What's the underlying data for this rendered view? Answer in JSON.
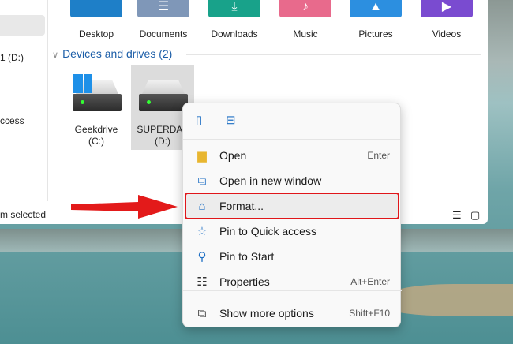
{
  "sidebar": {
    "items": [
      "1 (D:)",
      "ccess"
    ]
  },
  "folders": [
    {
      "label": "Desktop",
      "color": "#1e7fc8"
    },
    {
      "label": "Documents",
      "color": "#7f97b8"
    },
    {
      "label": "Downloads",
      "color": "#18a28a"
    },
    {
      "label": "Music",
      "color": "#e86a8c"
    },
    {
      "label": "Pictures",
      "color": "#2c8fe0"
    },
    {
      "label": "Videos",
      "color": "#7a4bd0"
    }
  ],
  "section": {
    "title": "Devices and drives (2)"
  },
  "drives": [
    {
      "name": "Geekdrive",
      "letter": "(C:)"
    },
    {
      "name": "SUPERDAV",
      "letter": "(D:)"
    }
  ],
  "status": {
    "text": "m selected"
  },
  "menu": {
    "items": [
      {
        "label": "Open",
        "shortcut": "Enter",
        "icon": "folder-icon"
      },
      {
        "label": "Open in new window",
        "shortcut": "",
        "icon": "open-new-window-icon"
      },
      {
        "label": "Format...",
        "shortcut": "",
        "icon": "format-icon"
      },
      {
        "label": "Pin to Quick access",
        "shortcut": "",
        "icon": "star-icon"
      },
      {
        "label": "Pin to Start",
        "shortcut": "",
        "icon": "pin-icon"
      },
      {
        "label": "Properties",
        "shortcut": "Alt+Enter",
        "icon": "properties-icon"
      }
    ],
    "more": {
      "label": "Show more options",
      "shortcut": "Shift+F10"
    }
  },
  "colors": {
    "highlight": "#e0161a",
    "accent": "#1e6fc4"
  }
}
